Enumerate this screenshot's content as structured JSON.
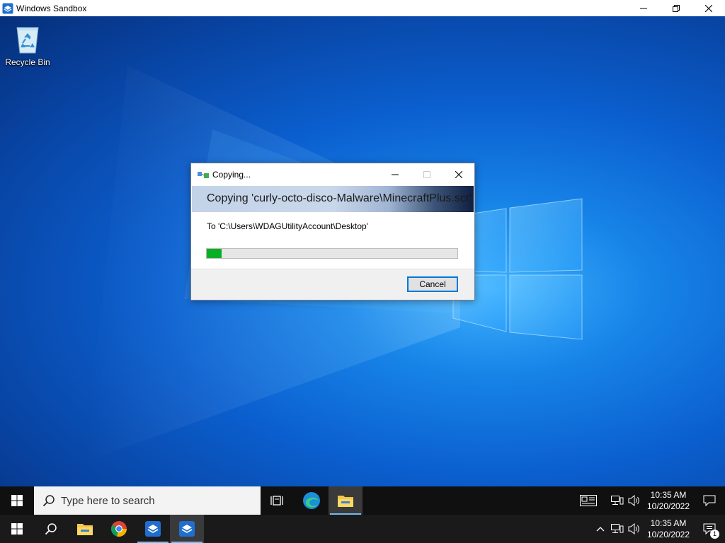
{
  "host_window": {
    "title": "Windows Sandbox",
    "controls": [
      "minimize-icon",
      "restore-icon",
      "close-icon"
    ]
  },
  "desktop": {
    "icons": [
      {
        "label": "Recycle Bin",
        "icon": "recycle-bin-icon"
      }
    ]
  },
  "copy_dialog": {
    "title": "Copying...",
    "banner": "Copying 'curly-octo-disco-Malware\\MinecraftPlus.scr'",
    "destination": "To 'C:\\Users\\WDAGUtilityAccount\\Desktop'",
    "progress_fraction": 0.06,
    "cancel_label": "Cancel",
    "progress_color": "#06b025"
  },
  "taskbar_inner": {
    "search_placeholder": "Type here to search",
    "pinned": [
      "task-view-icon",
      "edge-icon",
      "file-explorer-icon"
    ],
    "time": "10:35 AM",
    "date": "10/20/2022"
  },
  "taskbar_host": {
    "pinned": [
      "search-icon",
      "file-explorer-icon",
      "chrome-icon",
      "sandbox-icon",
      "sandbox-icon"
    ],
    "time": "10:35 AM",
    "date": "10/20/2022",
    "notification_count": "1"
  },
  "colors": {
    "accent": "#0078d7",
    "taskbar": "#101010"
  }
}
